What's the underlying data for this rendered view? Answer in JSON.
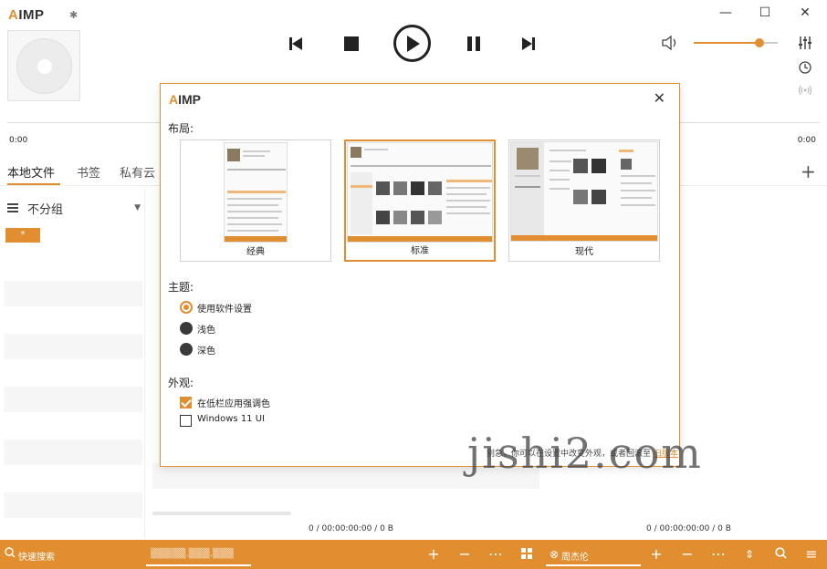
{
  "app": {
    "logo_prefix": "A",
    "logo_rest": "IMP",
    "accent": "#e08e30"
  },
  "window_controls": {
    "minimize": "—",
    "maximize": "☐",
    "close": "✕"
  },
  "player": {
    "time_elapsed": "0:00",
    "time_total": "0:00",
    "volume_level": 0.78
  },
  "tabs": [
    {
      "label": "本地文件"
    },
    {
      "label": "书签"
    },
    {
      "label": "私有云"
    }
  ],
  "left_panel": {
    "group_label": "不分组",
    "star_chip": "*"
  },
  "status": {
    "left_count": "0 / 00:00:00:00 / 0 B",
    "right_count": "0 / 00:00:00:00 / 0 B"
  },
  "bottom_bar": {
    "search_placeholder": "快速搜索",
    "playlist_left": "▒▒▒▒▒.▒▒▒.▒▒▒",
    "playlist_right": "周杰伦"
  },
  "dialog": {
    "logo_prefix": "A",
    "logo_rest": "IMP",
    "layout_label": "布局:",
    "layouts": [
      {
        "label": "经典"
      },
      {
        "label": "标准"
      },
      {
        "label": "现代"
      }
    ],
    "theme_label": "主题:",
    "themes": [
      {
        "label": "使用软件设置"
      },
      {
        "label": "浅色"
      },
      {
        "label": "深色"
      }
    ],
    "appearance_label": "外观:",
    "options": [
      {
        "label": "在低栏应用强调色",
        "checked": true
      },
      {
        "label": "Windows 11 UI",
        "checked": false
      }
    ],
    "tip_text": "别急，你可以在设置中改变外观，或者回滚至",
    "tip_link": "旧版本"
  },
  "watermark": "jishi2.com"
}
